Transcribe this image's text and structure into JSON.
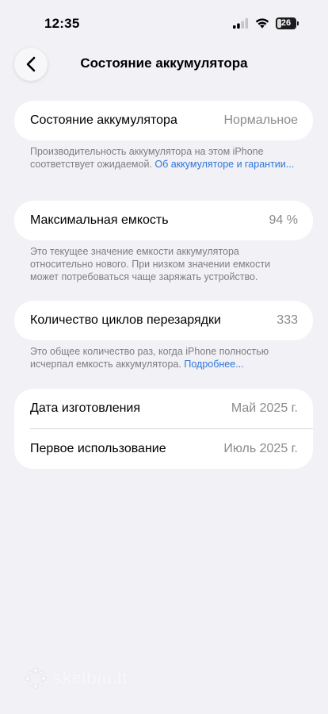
{
  "status_bar": {
    "time": "12:35",
    "battery_level": "26"
  },
  "nav": {
    "title": "Состояние аккумулятора",
    "back_icon": "chevron-left-icon"
  },
  "battery_health": {
    "label": "Состояние аккумулятора",
    "value": "Нормальное",
    "footnote_text": "Производительность аккумулятора на этом iPhone соответствует ожидаемой. ",
    "footnote_link": "Об аккумуляторе и гаран­тии..."
  },
  "max_capacity": {
    "label": "Максимальная емкость",
    "value": "94 %",
    "footnote_text": "Это текущее значение емкости аккумулятора относительно нового. При низком значении емкости может потребоваться чаще заряжать устройство."
  },
  "cycle_count": {
    "label": "Количество циклов перезарядки",
    "value": "333",
    "footnote_text": "Это общее количество раз, когда iPhone полностью исчерпал емкость аккумулятора. ",
    "footnote_link": "Подробнее..."
  },
  "dates": {
    "manufacture_label": "Дата изготовления",
    "manufacture_value": "Май 2025 г.",
    "first_use_label": "Первое использование",
    "first_use_value": "Июль 2025 г."
  },
  "watermark": {
    "text": "skelbiu.lt"
  },
  "colors": {
    "background": "#f1f1f6",
    "card": "#ffffff",
    "link": "#2f76d9",
    "secondary_text": "#8a8a8e"
  }
}
